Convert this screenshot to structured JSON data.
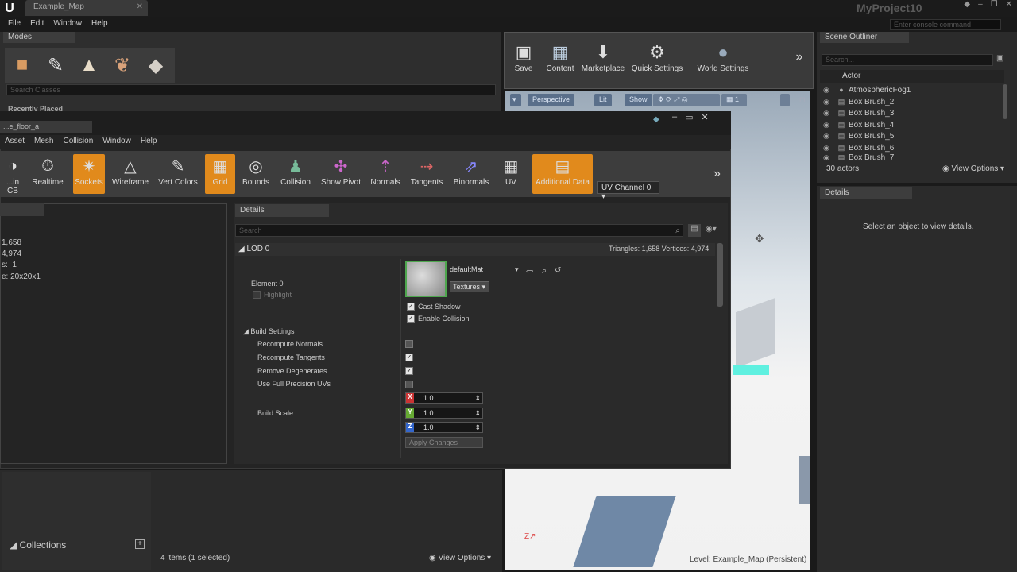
{
  "title_bar": {
    "tab": "Example_Map",
    "project": "MyProject10",
    "console_placeholder": "Enter console command"
  },
  "menubar": [
    "File",
    "Edit",
    "Window",
    "Help"
  ],
  "modes": {
    "tab": "Modes",
    "search_placeholder": "Search Classes",
    "recently_placed": "Recently Placed"
  },
  "main_toolbar": {
    "save": "Save",
    "content": "Content",
    "marketplace": "Marketplace",
    "quick_settings": "Quick Settings",
    "world_settings": "World Settings"
  },
  "viewport": {
    "perspective": "Perspective",
    "lit": "Lit",
    "show": "Show",
    "level": "Level:  Example_Map (Persistent)"
  },
  "outliner": {
    "tab": "Scene Outliner",
    "search_placeholder": "Search...",
    "column": "Actor",
    "rows": [
      "AtmosphericFog1",
      "Box Brush_2",
      "Box Brush_3",
      "Box Brush_4",
      "Box Brush_5",
      "Box Brush_6",
      "Box Brush_7"
    ],
    "count": "30 actors",
    "view_options": "View Options"
  },
  "details_right": {
    "tab": "Details",
    "message": "Select an object to view details."
  },
  "content_browser": {
    "collections": "Collections",
    "items": "4 items (1 selected)",
    "view_options": "View Options"
  },
  "mesh_editor": {
    "tab": "...e_floor_a",
    "menu": [
      "Asset",
      "Mesh",
      "Collision",
      "Window",
      "Help"
    ],
    "toolbar": [
      "...in CB",
      "Realtime",
      "Sockets",
      "Wireframe",
      "Vert Colors",
      "Grid",
      "Bounds",
      "Collision",
      "Show Pivot",
      "Normals",
      "Tangents",
      "Binormals",
      "UV",
      "Additional Data"
    ],
    "uv_channel": "UV Channel 0",
    "stats": [
      "1,658",
      "4,974",
      "1",
      "20x20x1"
    ],
    "stat_prefix": [
      "",
      "",
      "s:",
      "e:"
    ],
    "details": {
      "tab": "Details",
      "search_placeholder": "Search",
      "lod": "LOD 0",
      "triangles": "Triangles: 1,658   Vertices: 4,974",
      "element": "Element 0",
      "highlight": "Highlight",
      "material": "defaultMat",
      "textures": "Textures",
      "cast_shadow": "Cast Shadow",
      "enable_collision": "Enable Collision",
      "build_settings": "Build Settings",
      "recompute_normals": "Recompute Normals",
      "recompute_tangents": "Recompute Tangents",
      "remove_degenerates": "Remove Degenerates",
      "full_precision": "Use Full Precision UVs",
      "build_scale": "Build Scale",
      "scale_x": "1.0",
      "scale_y": "1.0",
      "scale_z": "1.0",
      "apply": "Apply Changes"
    }
  }
}
